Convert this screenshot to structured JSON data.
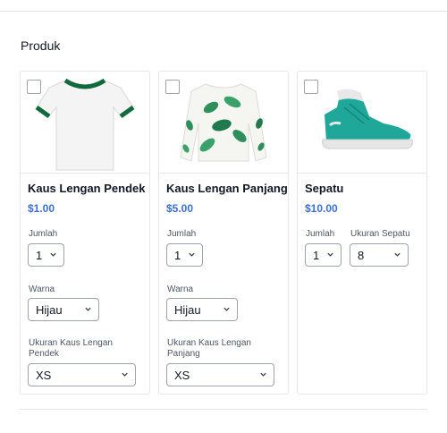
{
  "section": {
    "title": "Produk"
  },
  "products": [
    {
      "name": "Kaus Lengan Pendek",
      "price": "$1.00",
      "qty_label": "Jumlah",
      "qty_value": "1",
      "color_label": "Warna",
      "color_value": "Hijau",
      "size_label": "Ukuran Kaus Lengan Pendek",
      "size_value": "XS",
      "image_icon": "white-tshirt-green-trim"
    },
    {
      "name": "Kaus Lengan Panjang",
      "price": "$5.00",
      "qty_label": "Jumlah",
      "qty_value": "1",
      "color_label": "Warna",
      "color_value": "Hijau",
      "size_label": "Ukuran Kaus Lengan Panjang",
      "size_value": "XS",
      "image_icon": "leaf-print-sweatshirt"
    },
    {
      "name": "Sepatu",
      "price": "$10.00",
      "qty_label": "Jumlah",
      "qty_value": "1",
      "size_label": "Ukuran Sepatu",
      "size_value": "8",
      "image_icon": "teal-high-top-sneaker"
    }
  ],
  "colors": {
    "price": "#3b6fd8",
    "accent_green": "#1f7a4d",
    "sneaker_teal": "#1fa89a"
  }
}
